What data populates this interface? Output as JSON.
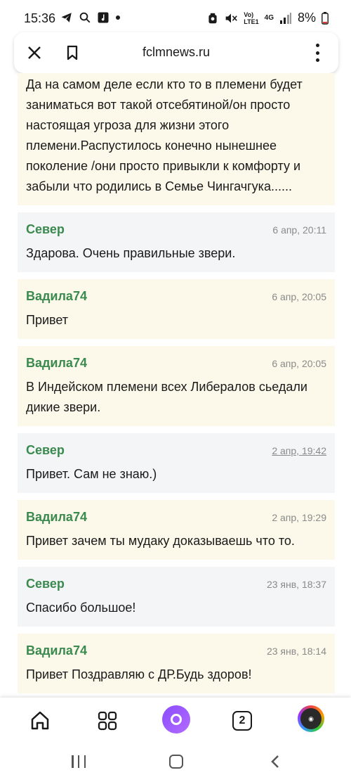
{
  "status_bar": {
    "time": "15:36",
    "battery": "8%",
    "network_vo": "Vo)",
    "network_lte": "LTE1",
    "network_4g": "4G",
    "left_icons": [
      "telegram-icon",
      "search-icon",
      "music-app-icon",
      "dot-icon"
    ],
    "right_icons": [
      "alarm-icon",
      "mute-icon",
      "signal-icon",
      "battery-icon"
    ]
  },
  "url_bar": {
    "domain": "fclmnews.ru"
  },
  "messages": [
    {
      "author": "",
      "date": "",
      "text": "Да на самом деле если кто то в племени будет заниматься вот такой отсебятиной/он просто настоящая угроза для жизни этого племени.Распустилось конечно нынешнее поколение /они просто привыкли к комфорту и забыли что родились в Семье Чингачгука......",
      "style": "beige"
    },
    {
      "author": "Север",
      "date": "6 апр, 20:11",
      "text": "Здарова. Очень правильные звери.",
      "style": "gray"
    },
    {
      "author": "Вадила74",
      "date": "6 апр, 20:05",
      "text": "Привет",
      "style": "beige"
    },
    {
      "author": "Вадила74",
      "date": "6 апр, 20:05",
      "text": "В Индейском племени всех Либералов сьедали дикие звери.",
      "style": "beige"
    },
    {
      "author": "Север",
      "date": "2 апр, 19:42",
      "text": "Привет. Сам не знаю.)",
      "style": "gray",
      "date_underlined": true
    },
    {
      "author": "Вадила74",
      "date": "2 апр, 19:29",
      "text": "Привет зачем ты мудаку доказываешь что то.",
      "style": "beige"
    },
    {
      "author": "Север",
      "date": "23 янв, 18:37",
      "text": "Спасибо большое!",
      "style": "gray"
    },
    {
      "author": "Вадила74",
      "date": "23 янв, 18:14",
      "text": "Привет Поздравляю с ДР.Будь здоров!",
      "style": "beige"
    }
  ],
  "bottom_nav": {
    "tabs_count": "2",
    "items": [
      "home-icon",
      "apps-grid-icon",
      "alice-assistant-icon",
      "tabs-counter-icon",
      "profile-avatar-icon"
    ]
  },
  "system_nav": {
    "items": [
      "recents-icon",
      "home-circle-icon",
      "back-icon"
    ]
  },
  "colors": {
    "author_green": "#3a8a4f",
    "message_beige": "#fcf8ea",
    "message_gray": "#f4f5f7",
    "alice_purple": "#8a4cff"
  }
}
